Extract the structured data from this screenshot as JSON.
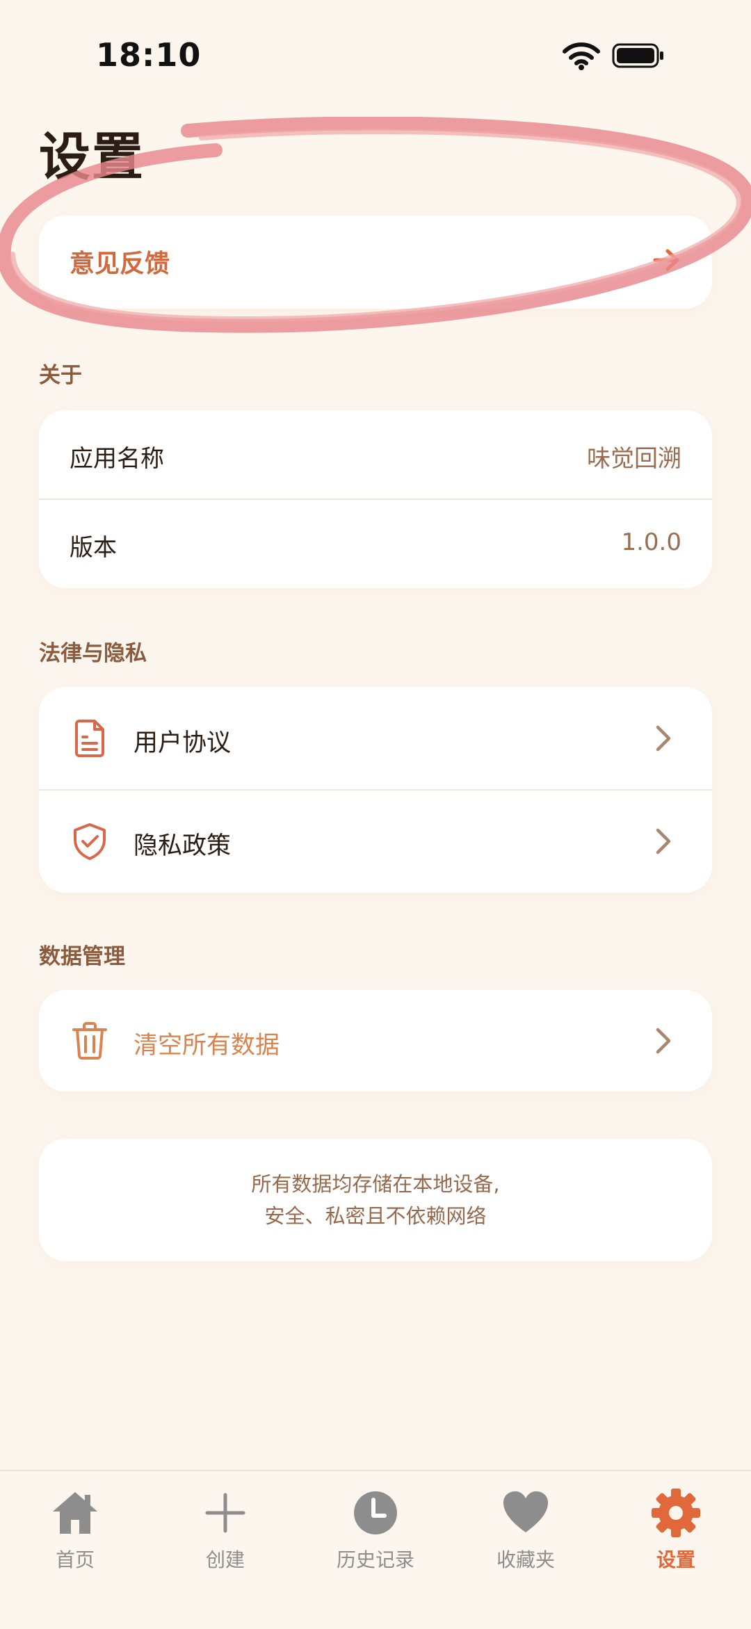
{
  "status_bar": {
    "time": "18:10"
  },
  "page": {
    "title": "设置"
  },
  "feedback": {
    "label": "意见反馈",
    "icon": "arrow-right-icon"
  },
  "about": {
    "section_title": "关于",
    "rows": [
      {
        "label": "应用名称",
        "value": "味觉回溯"
      },
      {
        "label": "版本",
        "value": "1.0.0"
      }
    ]
  },
  "legal": {
    "section_title": "法律与隐私",
    "rows": [
      {
        "label": "用户协议",
        "icon": "document-icon"
      },
      {
        "label": "隐私政策",
        "icon": "shield-check-icon"
      }
    ]
  },
  "data_management": {
    "section_title": "数据管理",
    "rows": [
      {
        "label": "清空所有数据",
        "icon": "trash-icon"
      }
    ]
  },
  "info": {
    "line1": "所有数据均存储在本地设备,",
    "line2": "安全、私密且不依赖网络"
  },
  "tab_bar": {
    "active_index": 4,
    "items": [
      {
        "label": "首页",
        "icon": "home-icon"
      },
      {
        "label": "创建",
        "icon": "plus-icon"
      },
      {
        "label": "历史记录",
        "icon": "clock-icon"
      },
      {
        "label": "收藏夹",
        "icon": "heart-icon"
      },
      {
        "label": "设置",
        "icon": "gear-icon"
      }
    ]
  },
  "colors": {
    "background": "#fdf6ee",
    "accent": "#e0683a",
    "text_primary": "#2b1d14",
    "text_secondary": "#8a5b3e",
    "warning": "#d9844f",
    "inactive": "#8d8d8d",
    "annotation": "#e8888c"
  }
}
